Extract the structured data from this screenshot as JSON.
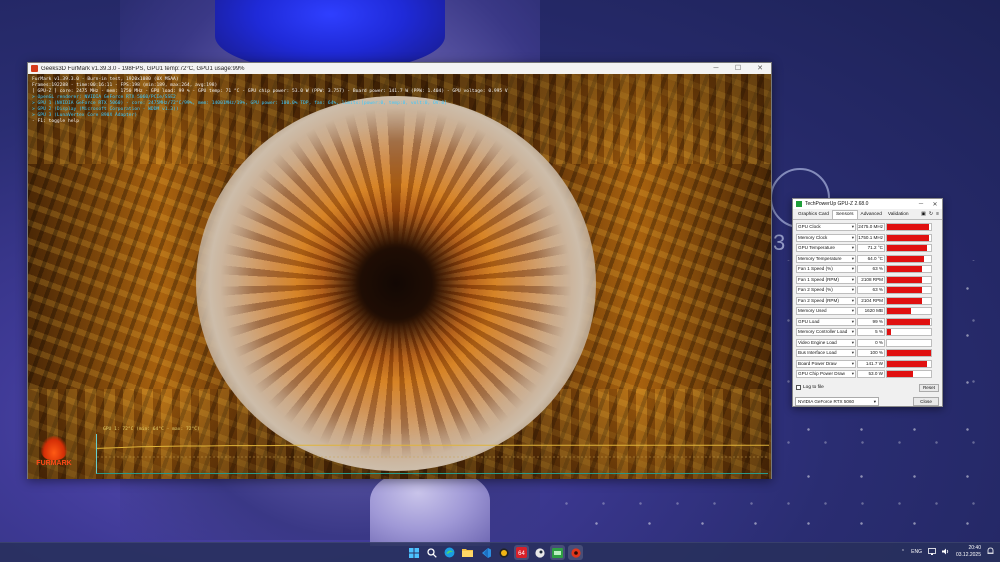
{
  "furmark": {
    "window_title": "Geeks3D FurMark v1.39.3.0 - 198FPS, GPU1 temp:72°C, GPU1 usage:99%",
    "osd": [
      {
        "text": "FurMark v1.39.3.0 - Burn-in test, 1920x1080 (0X MSAA)",
        "color": "white"
      },
      {
        "text": "Frames:192288 - time:00:16:11 - FPS:198 (min:189, max:264, avg:198)",
        "color": "white"
      },
      {
        "text": "[ GPU-Z ] core: 2475 MHz - mem: 1750 MHz - GPU load: 99 % - GPU temp: 71 °C - GPU chip power: 53.0 W (PPW: 3.757) - Board power: 141.7 W (PPW: 1.404) - GPU voltage: 0.995 V",
        "color": "white"
      },
      {
        "text": "> OpenGL renderer: NVIDIA GeForce RTX 5060/PCIe/SSE2",
        "color": "cyan"
      },
      {
        "text": "> GPU 1 (NVIDIA GeForce RTX 5060) - core: 2475MHz/72°C/99%, mem: 14001MHz/19%, GPU power: 100.0% TDP, fan: 64%, limits:[power:0, temp:0, volt:0, OV:0]",
        "color": "cyan"
      },
      {
        "text": "> GPU 2 (Display (Microsoft Corporation - WDDM v1.3))",
        "color": "cyan"
      },
      {
        "text": "> GPU 3 (LunaVertex Core 890X Adapter)",
        "color": "cyan"
      },
      {
        "text": "- F1: toggle help",
        "color": "white"
      }
    ],
    "graph_label": "GPU 1: 72°C (min: 64°C - max: 72°C)",
    "logo_text": "FURMARK",
    "graph_series": [
      64,
      66,
      68,
      69,
      70,
      70,
      71,
      71,
      71,
      72,
      72,
      72,
      72,
      72,
      72,
      72,
      72,
      72,
      72,
      72,
      72,
      72,
      72,
      72,
      72,
      72,
      72,
      72,
      72,
      72,
      72,
      72
    ],
    "graph_range": [
      0,
      100
    ]
  },
  "gpuz": {
    "window_title": "TechPowerUp GPU-Z 2.68.0",
    "tabs": [
      "Graphics Card",
      "Sensors",
      "Advanced",
      "Validation"
    ],
    "active_tab": "Sensors",
    "sensors": [
      {
        "name": "GPU Clock",
        "value": "2475.0 MHz",
        "level": 0.95
      },
      {
        "name": "Memory Clock",
        "value": "1750.1 MHz",
        "level": 0.95
      },
      {
        "name": "GPU Temperature",
        "value": "71.2 °C",
        "level": 0.9
      },
      {
        "name": "Memory Temperature",
        "value": "64.0 °C",
        "level": 0.85
      },
      {
        "name": "Fan 1 Speed (%)",
        "value": "63 %",
        "level": 0.8
      },
      {
        "name": "Fan 1 Speed (RPM)",
        "value": "2108 RPM",
        "level": 0.8
      },
      {
        "name": "Fan 2 Speed (%)",
        "value": "63 %",
        "level": 0.8
      },
      {
        "name": "Fan 2 Speed (RPM)",
        "value": "2104 RPM",
        "level": 0.8
      },
      {
        "name": "Memory Used",
        "value": "1620 MB",
        "level": 0.55
      },
      {
        "name": "GPU Load",
        "value": "99 %",
        "level": 0.97
      },
      {
        "name": "Memory Controller Load",
        "value": "5 %",
        "level": 0.08
      },
      {
        "name": "Video Engine Load",
        "value": "0 %",
        "level": 0.0
      },
      {
        "name": "Bus Interface Load",
        "value": "100 %",
        "level": 1.0
      },
      {
        "name": "Board Power Draw",
        "value": "141.7 W",
        "level": 0.9
      },
      {
        "name": "GPU Chip Power Draw",
        "value": "53.0 W",
        "level": 0.6
      }
    ],
    "log_label": "Log to file",
    "reset_label": "Reset",
    "device": "NVIDIA GeForce RTX 5060",
    "close_label": "Close",
    "bar_color": "#e01010"
  },
  "taskbar": {
    "apps": [
      "windows-start-icon",
      "search-icon",
      "edge-icon",
      "file-explorer-icon",
      "vscode-icon",
      "msi-afterburner-icon",
      "aida64-icon",
      "steam-icon",
      "gpuz-icon",
      "furmark-icon"
    ],
    "tray_lang": "ENG",
    "time": "20:40",
    "date": "03.12.2025"
  }
}
